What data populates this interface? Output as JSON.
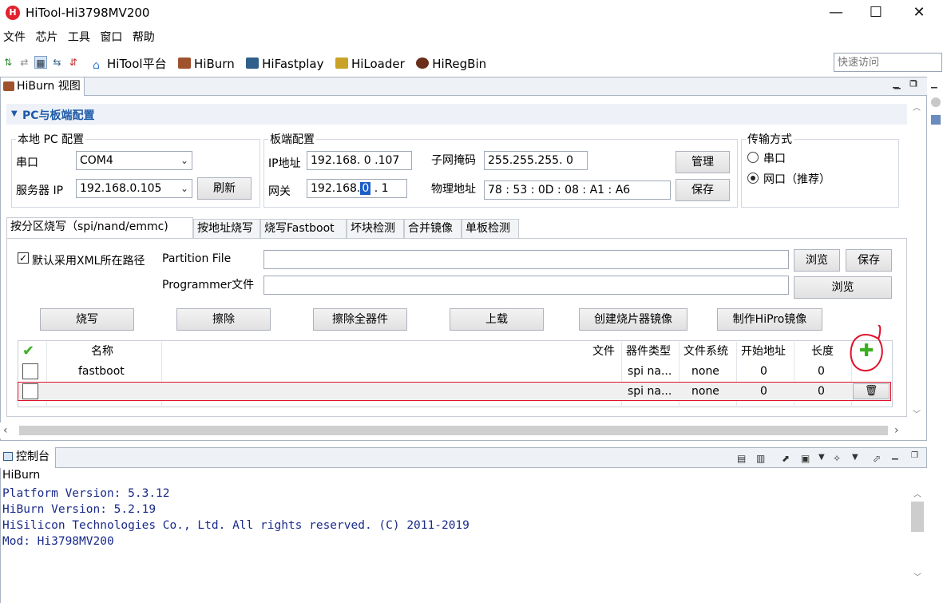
{
  "window": {
    "title": "HiTool-Hi3798MV200",
    "icon_glyph": "H",
    "minimize": "—",
    "maximize": "☐",
    "close": "✕"
  },
  "menu": [
    "文件",
    "芯片",
    "工具",
    "窗口",
    "帮助"
  ],
  "toolbar": {
    "buttons": [
      {
        "label": "HiTool平台",
        "icon": "home-icon",
        "color": "#3a7bd5"
      },
      {
        "label": "HiBurn",
        "icon": "burn-icon",
        "color": "#a0522d"
      },
      {
        "label": "HiFastplay",
        "icon": "fastplay-icon",
        "color": "#2f5f8a"
      },
      {
        "label": "HiLoader",
        "icon": "loader-icon",
        "color": "#c9a227"
      },
      {
        "label": "HiRegBin",
        "icon": "regbin-icon",
        "color": "#6b2e1a"
      }
    ],
    "quick_access_placeholder": "快速访问"
  },
  "view": {
    "tab_label": "HiBurn 视图",
    "section_title": "PC与板端配置"
  },
  "local_pc": {
    "group_label": "本地 PC 配置",
    "serial_label": "串口",
    "serial_value": "COM4",
    "server_ip_label": "服务器 IP",
    "server_ip_value": "192.168.0.105",
    "refresh_button": "刷新"
  },
  "board": {
    "group_label": "板端配置",
    "ip_label": "IP地址",
    "ip_value": "192.168. 0 .107",
    "gateway_label": "网关",
    "gateway_prefix": "192.168.",
    "gateway_selected": "0",
    "gateway_suffix": ". 1",
    "subnet_label": "子网掩码",
    "subnet_value": "255.255.255. 0",
    "mac_label": "物理地址",
    "mac_value": "78 : 53 : 0D : 08 : A1 : A6",
    "manage_button": "管理",
    "save_button": "保存"
  },
  "transfer": {
    "group_label": "传输方式",
    "option_serial": "串口",
    "option_network": "网口（推荐）",
    "selected": "network"
  },
  "tabs": [
    "按分区烧写（spi/nand/emmc)",
    "按地址烧写",
    "烧写Fastboot",
    "坏块检测",
    "合并镜像",
    "单板检测"
  ],
  "partition": {
    "use_xml_path_label": "默认采用XML所在路径",
    "use_xml_path_checked": true,
    "partition_file_label": "Partition File",
    "partition_file_value": "",
    "programmer_file_label": "Programmer文件",
    "programmer_file_value": "",
    "browse_button": "浏览",
    "save_button": "保存",
    "browse_button_2": "浏览"
  },
  "actions": [
    "烧写",
    "擦除",
    "擦除全器件",
    "上载",
    "创建烧片器镜像",
    "制作HiPro镜像"
  ],
  "table": {
    "columns": {
      "name": "名称",
      "file": "文件",
      "device_type": "器件类型",
      "filesystem": "文件系统",
      "start_addr": "开始地址",
      "length": "长度"
    },
    "rows": [
      {
        "name": "fastboot",
        "file": "",
        "device_type": "spi na...",
        "filesystem": "none",
        "start_addr": "0",
        "length": "0"
      },
      {
        "name": "",
        "file": "",
        "device_type": "spi na...",
        "filesystem": "none",
        "start_addr": "0",
        "length": "0"
      }
    ]
  },
  "console": {
    "tab_label": "控制台",
    "source": "HiBurn",
    "lines": [
      "Platform Version: 5.3.12",
      "HiBurn Version: 5.2.19",
      "HiSilicon Technologies Co., Ltd. All rights reserved. (C) 2011-2019",
      "Mod: Hi3798MV200"
    ]
  },
  "colors": {
    "accent_blue": "#1e5aa8",
    "console_text": "#1a2a8a",
    "annotation_red": "#e0102a",
    "add_green": "#3bb020"
  }
}
